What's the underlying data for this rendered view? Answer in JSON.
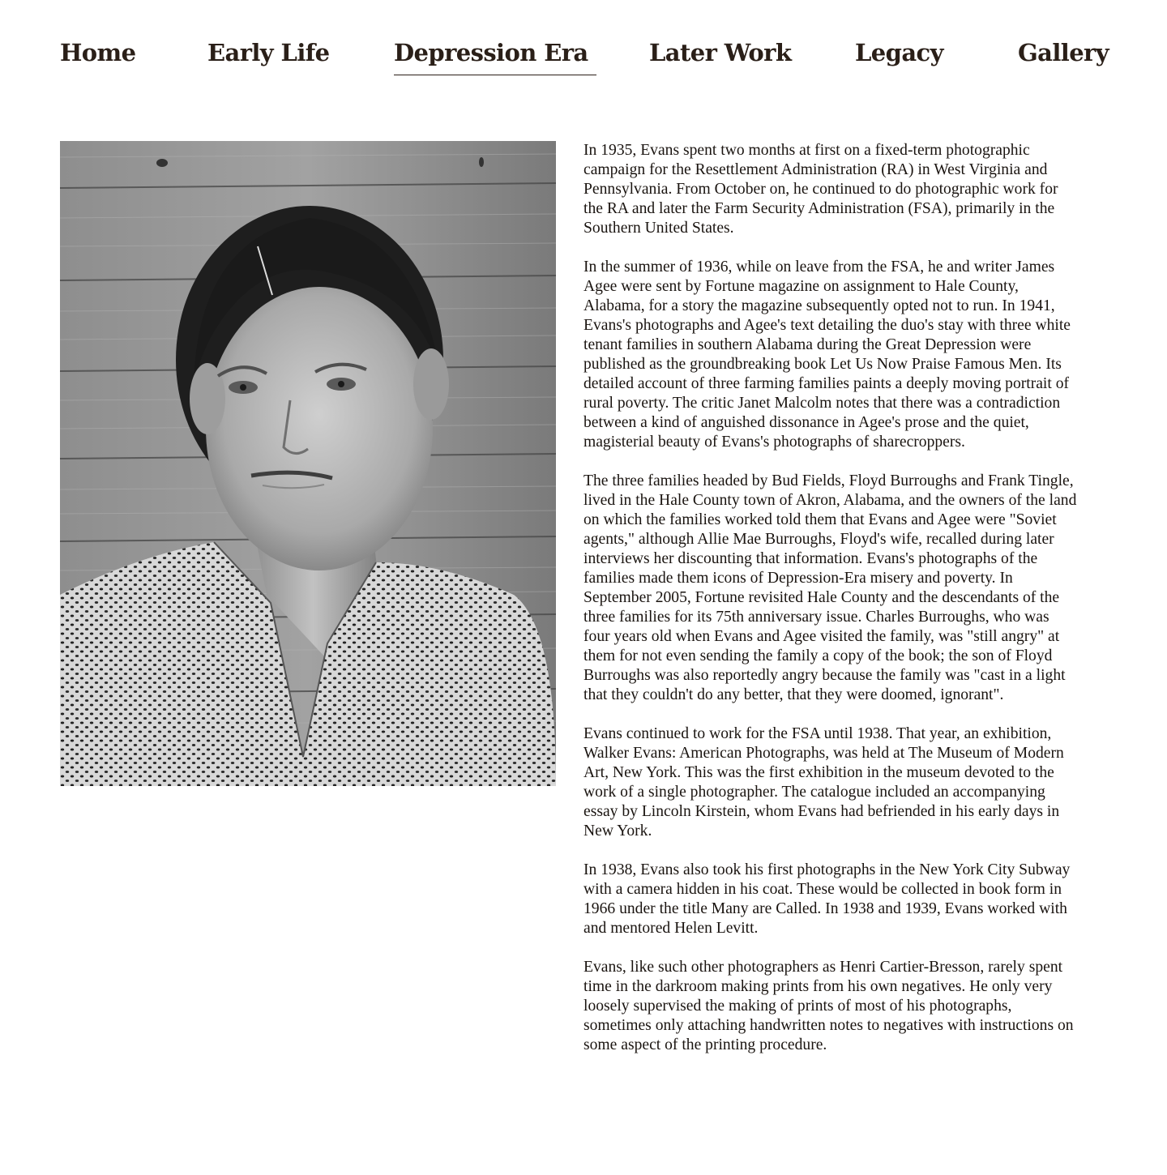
{
  "nav": {
    "items": [
      {
        "label": "Home"
      },
      {
        "label": "Early Life"
      },
      {
        "label": "Depression Era",
        "active": true
      },
      {
        "label": "Later Work"
      },
      {
        "label": "Legacy"
      },
      {
        "label": "Gallery"
      }
    ]
  },
  "photo": {
    "alt": "Black and white portrait of a woman standing against weathered wooden boards"
  },
  "article": {
    "paragraphs": [
      "In 1935, Evans spent two months at first on a fixed-term photographic campaign for the Resettlement Administration (RA) in West Virginia and Pennsylvania. From October on, he continued to do photographic work for the RA and later the Farm Security Administration (FSA), primarily in the Southern United States.",
      "In the summer of 1936, while on leave from the FSA, he and writer James Agee were sent by Fortune magazine on assignment to Hale County, Alabama, for a story the magazine subsequently opted not to run. In 1941, Evans's photographs and Agee's text detailing the duo's stay with three white tenant families in southern Alabama during the Great Depression were published as the groundbreaking book Let Us Now Praise Famous Men. Its detailed account of three farming families paints a deeply moving portrait of rural poverty. The critic Janet Malcolm notes that there was a contradiction between a kind of anguished dissonance in Agee's prose and the quiet, magisterial beauty of Evans's photographs of sharecroppers.",
      "The three families headed by Bud Fields, Floyd Burroughs and Frank Tingle, lived in the Hale County town of Akron, Alabama, and the owners of the land on which the families worked told them that Evans and Agee were \"Soviet agents,\" although Allie Mae Burroughs, Floyd's wife, recalled during later interviews her discounting that information. Evans's photographs of the families made them icons of Depression-Era misery and poverty. In September 2005, Fortune revisited Hale County and the descendants of the three families for its 75th anniversary issue. Charles Burroughs, who was four years old when Evans and Agee visited the family, was \"still angry\" at them for not even sending the family a copy of the book; the son of Floyd Burroughs was also reportedly angry because the family was \"cast in a light that they couldn't do any better, that they were doomed, ignorant\".",
      "Evans continued to work for the FSA until 1938. That year, an exhibition, Walker Evans: American Photographs, was held at The Museum of Modern Art, New York. This was the first exhibition in the museum devoted to the work of a single photographer. The catalogue included an accompanying essay by Lincoln Kirstein, whom Evans had befriended in his early days in New York.",
      "In 1938, Evans also took his first photographs in the New York City Subway with a camera hidden in his coat. These would be collected in book form in 1966 under the title Many are Called. In 1938 and 1939, Evans worked with and mentored Helen Levitt.",
      "Evans, like such other photographers as Henri Cartier-Bresson, rarely spent time in the darkroom making prints from his own negatives. He only very loosely supervised the making of prints of most of his photographs, sometimes only attaching handwritten notes to negatives with instructions on some aspect of the printing procedure."
    ]
  }
}
